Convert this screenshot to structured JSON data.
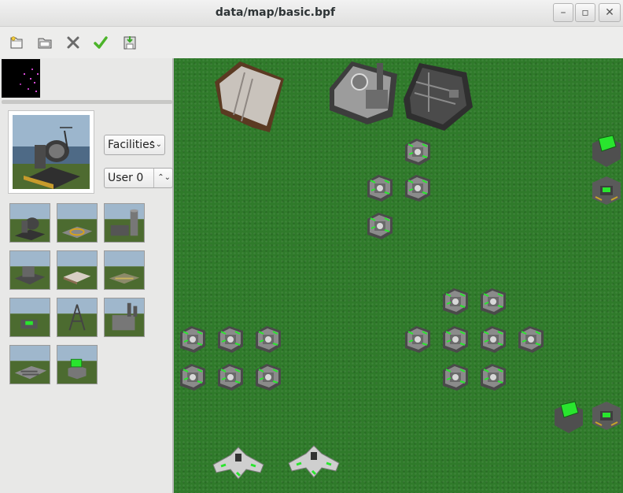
{
  "window": {
    "title": "data/map/basic.bpf",
    "controls": {
      "minimize": "–",
      "maximize": "▫",
      "close": "✕"
    }
  },
  "toolbar": {
    "buttons": [
      {
        "name": "new-file-button",
        "icon": "new-file-icon"
      },
      {
        "name": "open-folder-button",
        "icon": "folder-open-icon"
      },
      {
        "name": "close-button",
        "icon": "close-x-icon"
      },
      {
        "name": "apply-button",
        "icon": "checkmark-icon"
      },
      {
        "name": "save-button",
        "icon": "save-disk-icon"
      }
    ]
  },
  "sidebar": {
    "category_select": {
      "value": "Facilities"
    },
    "user_select": {
      "value": "User 0"
    },
    "palette_count": 11
  },
  "colors": {
    "grass": "#2f7a2a",
    "unit_green": "#29e52e",
    "metal": "#8a8a8a"
  }
}
